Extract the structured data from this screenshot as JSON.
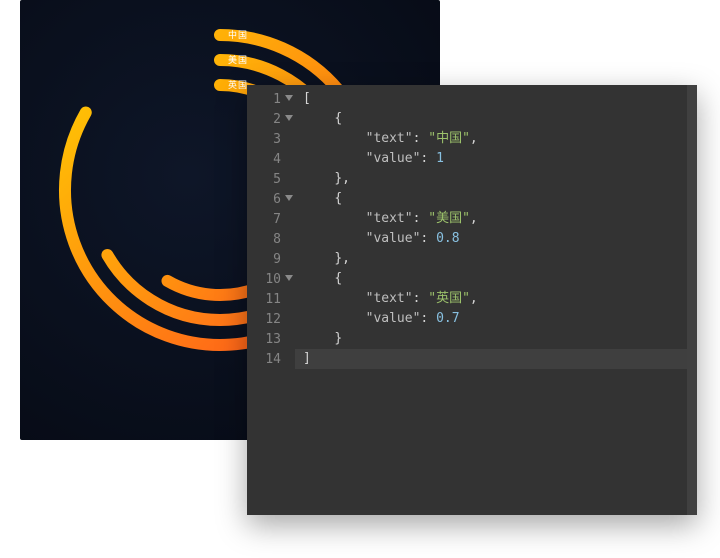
{
  "chart_data": {
    "type": "radial-bar",
    "series": [
      {
        "text": "中国",
        "value": 1.0,
        "color_start": "#ff4b1f",
        "color_end": "#ffd200"
      },
      {
        "text": "美国",
        "value": 0.8,
        "color_start": "#ff5a1f",
        "color_end": "#ffce00"
      },
      {
        "text": "英国",
        "value": 0.7,
        "color_start": "#ff5a1f",
        "color_end": "#ffbf00"
      }
    ],
    "max_angle_deg": 300,
    "start_angle_deg": -90,
    "center": {
      "x": 200,
      "y": 190
    },
    "ring_radii": [
      155,
      130,
      105
    ],
    "stroke_width": 12
  },
  "editor": {
    "lines": [
      {
        "n": "1",
        "fold": true,
        "indent": 0,
        "tokens": [
          {
            "t": "[",
            "c": "brace"
          }
        ]
      },
      {
        "n": "2",
        "fold": true,
        "indent": 1,
        "tokens": [
          {
            "t": "{",
            "c": "brace"
          }
        ]
      },
      {
        "n": "3",
        "fold": false,
        "indent": 2,
        "tokens": [
          {
            "t": "\"text\"",
            "c": "key"
          },
          {
            "t": ": ",
            "c": "punc"
          },
          {
            "t": "\"中国\"",
            "c": "string"
          },
          {
            "t": ",",
            "c": "punc"
          }
        ]
      },
      {
        "n": "4",
        "fold": false,
        "indent": 2,
        "tokens": [
          {
            "t": "\"value\"",
            "c": "key"
          },
          {
            "t": ": ",
            "c": "punc"
          },
          {
            "t": "1",
            "c": "number"
          }
        ]
      },
      {
        "n": "5",
        "fold": false,
        "indent": 1,
        "tokens": [
          {
            "t": "},",
            "c": "brace"
          }
        ]
      },
      {
        "n": "6",
        "fold": true,
        "indent": 1,
        "tokens": [
          {
            "t": "{",
            "c": "brace"
          }
        ]
      },
      {
        "n": "7",
        "fold": false,
        "indent": 2,
        "tokens": [
          {
            "t": "\"text\"",
            "c": "key"
          },
          {
            "t": ": ",
            "c": "punc"
          },
          {
            "t": "\"美国\"",
            "c": "string"
          },
          {
            "t": ",",
            "c": "punc"
          }
        ]
      },
      {
        "n": "8",
        "fold": false,
        "indent": 2,
        "tokens": [
          {
            "t": "\"value\"",
            "c": "key"
          },
          {
            "t": ": ",
            "c": "punc"
          },
          {
            "t": "0.8",
            "c": "number"
          }
        ]
      },
      {
        "n": "9",
        "fold": false,
        "indent": 1,
        "tokens": [
          {
            "t": "},",
            "c": "brace"
          }
        ]
      },
      {
        "n": "10",
        "fold": true,
        "indent": 1,
        "tokens": [
          {
            "t": "{",
            "c": "brace"
          }
        ]
      },
      {
        "n": "11",
        "fold": false,
        "indent": 2,
        "tokens": [
          {
            "t": "\"text\"",
            "c": "key"
          },
          {
            "t": ": ",
            "c": "punc"
          },
          {
            "t": "\"英国\"",
            "c": "string"
          },
          {
            "t": ",",
            "c": "punc"
          }
        ]
      },
      {
        "n": "12",
        "fold": false,
        "indent": 2,
        "tokens": [
          {
            "t": "\"value\"",
            "c": "key"
          },
          {
            "t": ": ",
            "c": "punc"
          },
          {
            "t": "0.7",
            "c": "number"
          }
        ]
      },
      {
        "n": "13",
        "fold": false,
        "indent": 1,
        "tokens": [
          {
            "t": "}",
            "c": "brace"
          }
        ]
      },
      {
        "n": "14",
        "fold": false,
        "indent": 0,
        "tokens": [
          {
            "t": "]",
            "c": "brace"
          }
        ],
        "active": true
      }
    ]
  }
}
